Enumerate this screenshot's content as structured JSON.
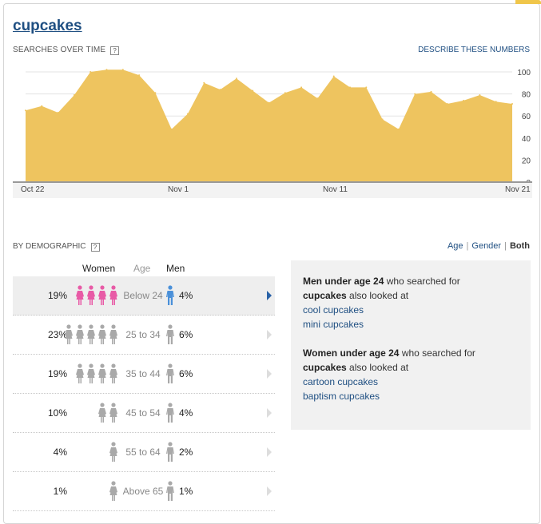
{
  "title": "cupcakes",
  "searches": {
    "label": "SEARCHES OVER TIME",
    "help": "?",
    "describe_link": "DESCRIBE THESE NUMBERS"
  },
  "chart_data": {
    "type": "area",
    "title": "",
    "xlabel": "",
    "ylabel": "",
    "ylim": [
      0,
      100
    ],
    "yticks": [
      0,
      20,
      40,
      60,
      80,
      100
    ],
    "xtick_labels": [
      "Oct 22",
      "Nov 1",
      "Nov 11",
      "Nov 21"
    ],
    "x": [
      "Oct 22",
      "Oct 23",
      "Oct 24",
      "Oct 25",
      "Oct 26",
      "Oct 27",
      "Oct 28",
      "Oct 29",
      "Oct 30",
      "Oct 31",
      "Nov 1",
      "Nov 2",
      "Nov 3",
      "Nov 4",
      "Nov 5",
      "Nov 6",
      "Nov 7",
      "Nov 8",
      "Nov 9",
      "Nov 10",
      "Nov 11",
      "Nov 12",
      "Nov 13",
      "Nov 14",
      "Nov 15",
      "Nov 16",
      "Nov 17",
      "Nov 18",
      "Nov 19",
      "Nov 20",
      "Nov 21"
    ],
    "values": [
      65,
      69,
      63,
      79,
      100,
      102,
      102,
      97,
      81,
      48,
      62,
      90,
      84,
      94,
      83,
      72,
      81,
      86,
      76,
      96,
      86,
      86,
      57,
      48,
      80,
      82,
      71,
      74,
      79,
      73,
      71
    ],
    "color": "#eec45f",
    "grid": true
  },
  "demographic": {
    "label": "BY DEMOGRAPHIC",
    "help": "?",
    "toggle": {
      "age": "Age",
      "gender": "Gender",
      "both": "Both",
      "sep": "|"
    },
    "headers": {
      "women": "Women",
      "age": "Age",
      "men": "Men"
    },
    "rows": [
      {
        "women_pct": "19%",
        "women_icons": 4,
        "age": "Below 24",
        "men_pct": "4%",
        "selected": true
      },
      {
        "women_pct": "23%",
        "women_icons": 5,
        "age": "25 to 34",
        "men_pct": "6%",
        "selected": false
      },
      {
        "women_pct": "19%",
        "women_icons": 4,
        "age": "35 to 44",
        "men_pct": "6%",
        "selected": false
      },
      {
        "women_pct": "10%",
        "women_icons": 2,
        "age": "45 to 54",
        "men_pct": "4%",
        "selected": false
      },
      {
        "women_pct": "4%",
        "women_icons": 1,
        "age": "55 to 64",
        "men_pct": "2%",
        "selected": false
      },
      {
        "women_pct": "1%",
        "women_icons": 1,
        "age": "Above 65",
        "men_pct": "1%",
        "selected": false
      }
    ],
    "colors": {
      "women_selected": "#e85aa6",
      "men_selected": "#4a90d9",
      "inactive": "#a9a9a9"
    }
  },
  "related": {
    "men": {
      "bold1": "Men under age 24",
      "txt1": "who searched for",
      "bold2": "cupcakes",
      "txt2": "also looked at",
      "links": [
        "cool cupcakes",
        "mini cupcakes"
      ]
    },
    "women": {
      "bold1": "Women under age 24",
      "txt1": "who searched for",
      "bold2": "cupcakes",
      "txt2": "also looked at",
      "links": [
        "cartoon cupcakes",
        "baptism cupcakes"
      ]
    }
  }
}
